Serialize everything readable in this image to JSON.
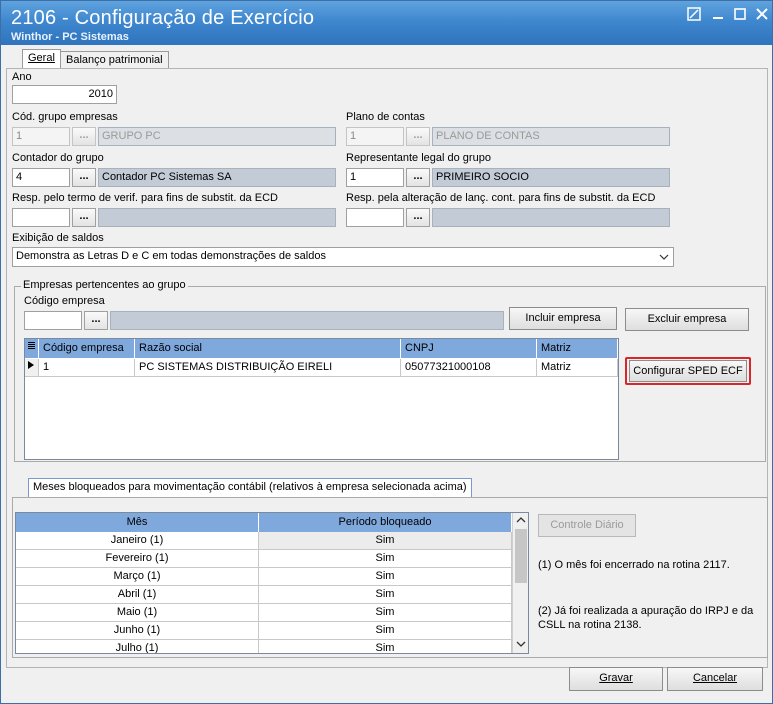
{
  "window": {
    "title": "2106 - Configuração de Exercício",
    "subtitle": "Winthor - PC Sistemas"
  },
  "tabs": [
    "Geral",
    "Balanço patrimonial"
  ],
  "form": {
    "ano_label": "Ano",
    "ano_value": "2010",
    "cod_grupo_label": "Cód. grupo empresas",
    "cod_grupo_value": "1",
    "grupo_desc": "GRUPO PC",
    "plano_label": "Plano de contas",
    "plano_value": "1",
    "plano_desc": "PLANO DE CONTAS",
    "contador_label": "Contador do grupo",
    "contador_value": "4",
    "contador_desc": "Contador PC Sistemas SA",
    "representante_label": "Representante legal do grupo",
    "representante_value": "1",
    "representante_desc": "PRIMEIRO SOCIO",
    "resp_termo_label": "Resp. pelo termo de verif. para fins de substit. da ECD",
    "resp_alteracao_label": "Resp. pela alteração de lanç. cont. para fins de substit. da ECD",
    "exibicao_label": "Exibição de saldos",
    "exibicao_value": "Demonstra as Letras D e C em todas demonstrações de saldos",
    "ellipsis": "..."
  },
  "empresas": {
    "group_label": "Empresas pertencentes ao grupo",
    "codigo_label": "Código  empresa",
    "incluir_label": "Incluir empresa",
    "excluir_label": "Excluir empresa",
    "configurar_label": "Configurar SPED ECF",
    "columns": [
      "Código empresa",
      "Razão social",
      "CNPJ",
      "Matriz"
    ],
    "rows": [
      [
        "1",
        "PC SISTEMAS DISTRIBUIÇÃO EIRELI",
        "05077321000108",
        "Matriz"
      ]
    ]
  },
  "meses": {
    "tab_label": "Meses bloqueados para movimentação contábil (relativos à empresa selecionada acima)",
    "columns": [
      "Mês",
      "Período bloqueado"
    ],
    "rows": [
      [
        "Janeiro (1)",
        "Sim"
      ],
      [
        "Fevereiro (1)",
        "Sim"
      ],
      [
        "Março (1)",
        "Sim"
      ],
      [
        "Abril (1)",
        "Sim"
      ],
      [
        "Maio (1)",
        "Sim"
      ],
      [
        "Junho (1)",
        "Sim"
      ],
      [
        "Julho (1)",
        "Sim"
      ]
    ],
    "controle_label": "Controle Diário",
    "note1": "(1)  O mês foi encerrado na rotina 2117.",
    "note2": "(2)  Já foi realizada a apuração do IRPJ e da CSLL na rotina 2138."
  },
  "footer": {
    "gravar_label": "Gravar",
    "cancelar_label": "Cancelar"
  },
  "colors": {
    "title_bar": "#3f87cf",
    "grid_header": "#7fa8dd",
    "highlight_border": "#d8262b"
  }
}
